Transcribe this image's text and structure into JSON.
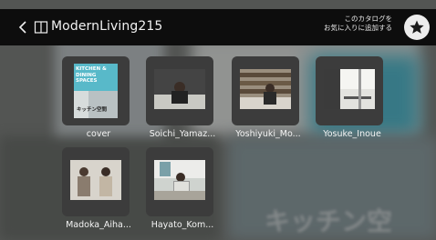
{
  "header": {
    "back_icon": "chevron-left-icon",
    "book_icon": "book-icon",
    "title": "ModernLiving215",
    "favorite_line1": "このカタログを",
    "favorite_line2": "お気に入りに追加する",
    "favorite_icon": "star-icon"
  },
  "pages": [
    {
      "label": "cover",
      "thumb": "cover",
      "cover_text": [
        "KITCHEN &",
        "DINING",
        "SPACES"
      ],
      "cover_jp": "キッチン空間"
    },
    {
      "label": "Soichi_Yamaz...",
      "thumb": "person-dark-room"
    },
    {
      "label": "Yoshiyuki_Mo...",
      "thumb": "person-bookshelf"
    },
    {
      "label": "Yosuke_Inoue",
      "thumb": "interior-room"
    },
    {
      "label": "Madoka_Aiha...",
      "thumb": "two-people"
    },
    {
      "label": "Hayato_Kom...",
      "thumb": "person-desk"
    }
  ],
  "background_text": "キッチン空"
}
